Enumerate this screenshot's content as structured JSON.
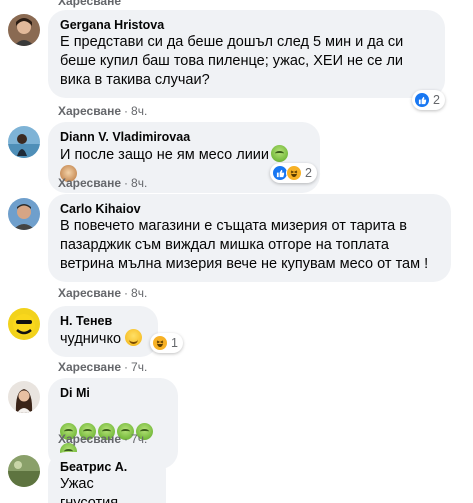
{
  "top_cutoff": {
    "like_label": "Харесване"
  },
  "labels": {
    "like": "Харесване",
    "dot": "·"
  },
  "colors": {
    "bubble": "#f0f2f5",
    "secondary_text": "#65676b",
    "like_blue": "#1877f2",
    "haha_yellow": "#f7b125"
  },
  "comments": [
    {
      "author": "Gergana Hristova",
      "text": "Е представи си да беше дошъл след 5 мин и да си беше купил баш това пиленце; ужас, ХЕИ не се ли вика в такива случаи?",
      "time": "8ч.",
      "reactions": {
        "icons": [
          "like-icon"
        ],
        "count": "2"
      }
    },
    {
      "author": "Diann V. Vladimirovaa",
      "text": "И после защо не ям месо лиии",
      "emojis": [
        "sick-face-icon",
        "see-no-evil-monkey-icon"
      ],
      "time": "8ч.",
      "reactions": {
        "icons": [
          "like-icon",
          "haha-icon"
        ],
        "count": "2"
      }
    },
    {
      "author": "Carlo Kihaiov",
      "text": "В повечето магазини е същата мизерия от тарита в пазарджик съм виждал мишка отгоре на топлата ветрина мълна мизерия вече не купувам месо от там !",
      "time": "8ч."
    },
    {
      "author": "Н. Тенев",
      "text": "чудничко",
      "emojis": [
        "smiling-face-icon"
      ],
      "time": "7ч.",
      "reactions": {
        "icons": [
          "haha-icon"
        ],
        "count": "1"
      }
    },
    {
      "author": "Di Mi",
      "text": "",
      "emojis": [
        "sick-face-icon",
        "sick-face-icon",
        "sick-face-icon",
        "sick-face-icon",
        "sick-face-icon",
        "sick-face-icon"
      ],
      "time": "7ч."
    },
    {
      "author": "Беатрис А.",
      "text": "Ужас гнусотия"
    }
  ]
}
